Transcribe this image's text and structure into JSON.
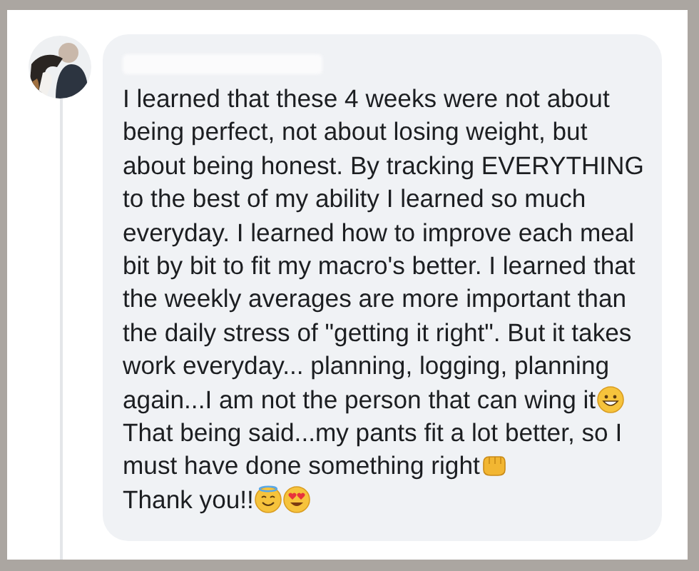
{
  "comment": {
    "paragraphs": [
      {
        "text": "I learned that these 4 weeks were not about being perfect, not about losing weight, but about being honest. By tracking EVERYTHING to the best of my ability I learned so much everyday. I learned how to improve each meal bit by bit to fit my macro's better. I learned that the weekly averages are more important than the daily stress of \"getting it right\". But it takes work everyday... planning, logging, planning again...I am not the person that can wing it",
        "icons": [
          {
            "kind": "grin"
          }
        ]
      },
      {
        "text": "That being said...my pants fit a lot better, so I must have done something right",
        "icons": [
          {
            "kind": "fist"
          }
        ]
      },
      {
        "text": "Thank you!!",
        "icons": [
          {
            "kind": "halo"
          },
          {
            "kind": "heart-eyes"
          }
        ]
      }
    ]
  }
}
